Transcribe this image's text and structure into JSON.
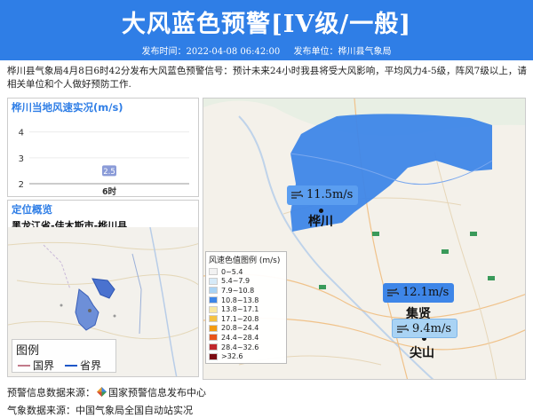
{
  "header": {
    "title": "大风蓝色预警[IV级/一般]",
    "publish_time": "发布时间：2022-04-08 06:42:00",
    "publisher": "发布单位：桦川县气象局"
  },
  "description": "桦川县气象局4月8日6时42分发布大风蓝色预警信号：预计未来24小时我县将受大风影响，平均风力4-5级，阵风7级以上，请相关单位和个人做好预防工作.",
  "wind_chart": {
    "title": "桦川当地风速实况(m/s)"
  },
  "chart_data": {
    "type": "scatter",
    "title": "桦川当地风速实况(m/s)",
    "categories": [
      "6时"
    ],
    "values": [
      2.5
    ],
    "yticks": [
      "2",
      "3",
      "4"
    ],
    "ylim": [
      2,
      4.4
    ],
    "data_labels": [
      "2.5"
    ]
  },
  "location": {
    "title": "定位概览",
    "region": "黑龙江省-佳木斯市-桦川县",
    "legend_title": "图例",
    "legend_items": [
      {
        "label": "国界",
        "color": "#c27a8a"
      },
      {
        "label": "省界",
        "color": "#1e57c8"
      }
    ]
  },
  "map": {
    "legend_title": "风速色值图例 (m/s)",
    "legend": [
      {
        "label": "0~5.4",
        "color": "#f2f2f2"
      },
      {
        "label": "5.4~7.9",
        "color": "#d6eaf8"
      },
      {
        "label": "7.9~10.8",
        "color": "#a9d3f4"
      },
      {
        "label": "10.8~13.8",
        "color": "#3e86e8"
      },
      {
        "label": "13.8~17.1",
        "color": "#f9e79f"
      },
      {
        "label": "17.1~20.8",
        "color": "#f5c242"
      },
      {
        "label": "20.8~24.4",
        "color": "#f39c12"
      },
      {
        "label": "24.4~28.4",
        "color": "#e8541b"
      },
      {
        "label": "28.4~32.6",
        "color": "#c0282d"
      },
      {
        "label": ">32.6",
        "color": "#7b0c12"
      }
    ],
    "stations": [
      {
        "speed": "11.5m/s",
        "color": "#5b9ef0"
      },
      {
        "speed": "12.1m/s",
        "color": "#3e86e8"
      },
      {
        "speed": "9.4m/s",
        "color": "#a9d3f4"
      }
    ],
    "cities": [
      "桦川",
      "集贤",
      "尖山"
    ]
  },
  "sources": {
    "warning_prefix": "预警信息数据来源：",
    "warning_source": "国家预警信息发布中心",
    "weather": "气象数据来源：中国气象局全国自动站实况"
  }
}
